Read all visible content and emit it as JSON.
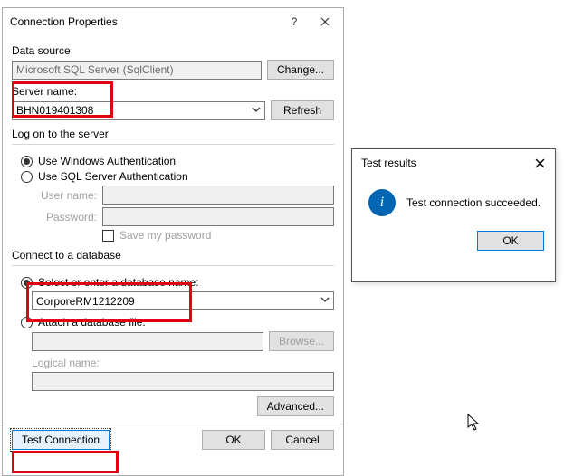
{
  "main": {
    "title": "Connection Properties",
    "dataSource": {
      "label": "Data source:",
      "value": "Microsoft SQL Server (SqlClient)",
      "changeBtn": "Change..."
    },
    "server": {
      "label": "Server name:",
      "value": "BHN019401308",
      "refreshBtn": "Refresh"
    },
    "logon": {
      "title": "Log on to the server",
      "winAuth": "Use Windows Authentication",
      "sqlAuth": "Use SQL Server Authentication",
      "userLabel": "User name:",
      "userValue": "",
      "passLabel": "Password:",
      "passValue": "",
      "savePwd": "Save my password"
    },
    "db": {
      "title": "Connect to a database",
      "selectOpt": "Select or enter a database name:",
      "dbValue": "CorporeRM1212209",
      "attachOpt": "Attach a database file:",
      "attachValue": "",
      "browseBtn": "Browse...",
      "logicalLabel": "Logical name:",
      "logicalValue": ""
    },
    "advancedBtn": "Advanced...",
    "footer": {
      "testBtn": "Test Connection",
      "okBtn": "OK",
      "cancelBtn": "Cancel"
    }
  },
  "popup": {
    "title": "Test results",
    "message": "Test connection succeeded.",
    "okBtn": "OK"
  }
}
